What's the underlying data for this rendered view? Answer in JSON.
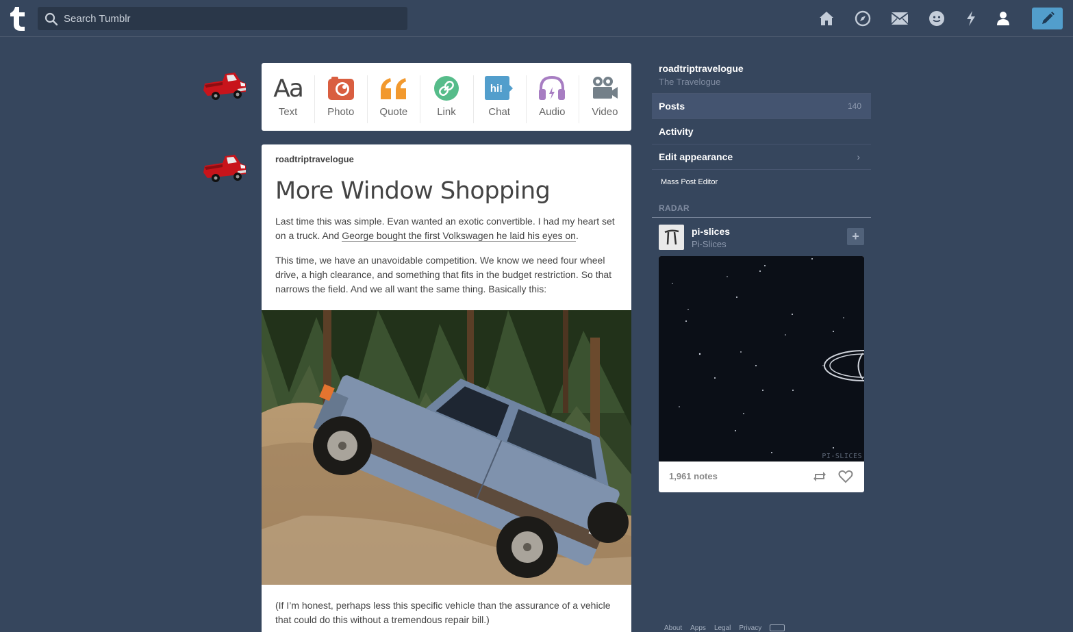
{
  "header": {
    "search_placeholder": "Search Tumblr",
    "logo_icon": "tumblr-t-icon",
    "nav_icons": [
      "home-icon",
      "explore-icon",
      "inbox-icon",
      "messaging-icon",
      "activity-icon",
      "account-icon"
    ],
    "compose_icon": "pencil-icon",
    "compose_color": "#529ecc"
  },
  "post_types": [
    {
      "label": "Text",
      "icon": "text-aa-icon",
      "color": "#444444"
    },
    {
      "label": "Photo",
      "icon": "camera-icon",
      "color": "#d95e40"
    },
    {
      "label": "Quote",
      "icon": "quote-icon",
      "color": "#f2992e"
    },
    {
      "label": "Link",
      "icon": "link-icon",
      "color": "#56bc8a"
    },
    {
      "label": "Chat",
      "icon": "chat-icon",
      "color": "#529ecc"
    },
    {
      "label": "Audio",
      "icon": "headphones-icon",
      "color": "#a77dc2"
    },
    {
      "label": "Video",
      "icon": "video-camera-icon",
      "color": "#748089"
    }
  ],
  "post": {
    "blog": "roadtriptravelogue",
    "title": "More Window Shopping",
    "p1_before": "Last time this was simple. Evan wanted an exotic convertible. I had my heart set on a truck. And ",
    "p1_link": "George bought the first Volkswagen he laid his eyes on",
    "p1_after": ".",
    "p2": "This time, we have an unavoidable competition. We know we need four wheel drive, a high clearance, and something that fits in the budget restriction. So that narrows the field. And we all want the same thing. Basically this:",
    "p3": "(If I’m honest, perhaps less this specific vehicle than the assurance of a vehicle that could do this without a tremendous repair bill.)"
  },
  "sidebar": {
    "blog_name": "roadtriptravelogue",
    "blog_title": "The Travelogue",
    "posts_label": "Posts",
    "posts_count": "140",
    "activity_label": "Activity",
    "edit_label": "Edit appearance",
    "mass_label": "Mass Post Editor",
    "radar_heading": "RADAR",
    "radar_blog": "pi-slices",
    "radar_title": "Pi-Slices",
    "follow_label": "+",
    "watermark": "PI-SLICES",
    "notes": "1,961 notes"
  },
  "footer": {
    "links": [
      "About",
      "Apps",
      "Legal",
      "Privacy"
    ]
  }
}
